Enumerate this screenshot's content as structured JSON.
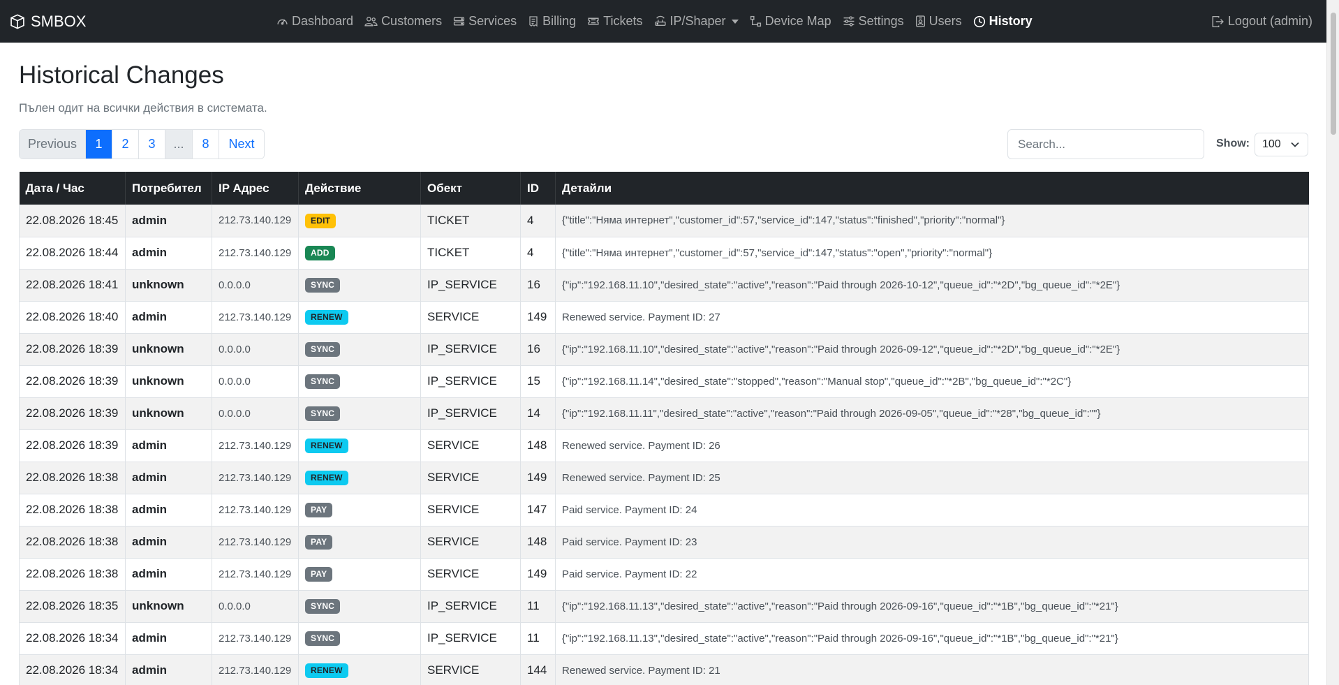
{
  "navbar": {
    "brand": "SMBOX",
    "items": [
      {
        "label": "Dashboard",
        "icon": "speedometer-icon"
      },
      {
        "label": "Customers",
        "icon": "people-icon"
      },
      {
        "label": "Services",
        "icon": "hdd-stack-icon"
      },
      {
        "label": "Billing",
        "icon": "receipt-icon"
      },
      {
        "label": "Tickets",
        "icon": "ticket-icon"
      },
      {
        "label": "IP/Shaper",
        "icon": "router-icon"
      },
      {
        "label": "Device Map",
        "icon": "diagram-icon"
      },
      {
        "label": "Settings",
        "icon": "sliders-icon"
      },
      {
        "label": "Users",
        "icon": "person-badge-icon"
      },
      {
        "label": "History",
        "icon": "clock-history-icon"
      }
    ],
    "logout": "Logout (admin)"
  },
  "header": {
    "title": "Historical Changes",
    "subtitle": "Пълен одит на всички действия в системата."
  },
  "pagination": {
    "previous": "Previous",
    "pages": [
      "1",
      "2",
      "3",
      "...",
      "8"
    ],
    "next": "Next"
  },
  "search": {
    "placeholder": "Search..."
  },
  "show": {
    "label": "Show:",
    "value": "100"
  },
  "table": {
    "columns": [
      "Дата / Час",
      "Потребител",
      "IP Адрес",
      "Действие",
      "Обект",
      "ID",
      "Детайли"
    ],
    "rows": [
      {
        "date": "22.08.2026 18:45",
        "user": "admin",
        "ip": "212.73.140.129",
        "action": "EDIT",
        "object": "TICKET",
        "id": "4",
        "details": "{\"title\":\"Няма интернет\",\"customer_id\":57,\"service_id\":147,\"status\":\"finished\",\"priority\":\"normal\"}"
      },
      {
        "date": "22.08.2026 18:44",
        "user": "admin",
        "ip": "212.73.140.129",
        "action": "ADD",
        "object": "TICKET",
        "id": "4",
        "details": "{\"title\":\"Няма интернет\",\"customer_id\":57,\"service_id\":147,\"status\":\"open\",\"priority\":\"normal\"}"
      },
      {
        "date": "22.08.2026 18:41",
        "user": "unknown",
        "ip": "0.0.0.0",
        "action": "SYNC",
        "object": "IP_SERVICE",
        "id": "16",
        "details": "{\"ip\":\"192.168.11.10\",\"desired_state\":\"active\",\"reason\":\"Paid through 2026-10-12\",\"queue_id\":\"*2D\",\"bg_queue_id\":\"*2E\"}"
      },
      {
        "date": "22.08.2026 18:40",
        "user": "admin",
        "ip": "212.73.140.129",
        "action": "RENEW",
        "object": "SERVICE",
        "id": "149",
        "details": "Renewed service. Payment ID: 27"
      },
      {
        "date": "22.08.2026 18:39",
        "user": "unknown",
        "ip": "0.0.0.0",
        "action": "SYNC",
        "object": "IP_SERVICE",
        "id": "16",
        "details": "{\"ip\":\"192.168.11.10\",\"desired_state\":\"active\",\"reason\":\"Paid through 2026-09-12\",\"queue_id\":\"*2D\",\"bg_queue_id\":\"*2E\"}"
      },
      {
        "date": "22.08.2026 18:39",
        "user": "unknown",
        "ip": "0.0.0.0",
        "action": "SYNC",
        "object": "IP_SERVICE",
        "id": "15",
        "details": "{\"ip\":\"192.168.11.14\",\"desired_state\":\"stopped\",\"reason\":\"Manual stop\",\"queue_id\":\"*2B\",\"bg_queue_id\":\"*2C\"}"
      },
      {
        "date": "22.08.2026 18:39",
        "user": "unknown",
        "ip": "0.0.0.0",
        "action": "SYNC",
        "object": "IP_SERVICE",
        "id": "14",
        "details": "{\"ip\":\"192.168.11.11\",\"desired_state\":\"active\",\"reason\":\"Paid through 2026-09-05\",\"queue_id\":\"*28\",\"bg_queue_id\":\"\"}"
      },
      {
        "date": "22.08.2026 18:39",
        "user": "admin",
        "ip": "212.73.140.129",
        "action": "RENEW",
        "object": "SERVICE",
        "id": "148",
        "details": "Renewed service. Payment ID: 26"
      },
      {
        "date": "22.08.2026 18:38",
        "user": "admin",
        "ip": "212.73.140.129",
        "action": "RENEW",
        "object": "SERVICE",
        "id": "149",
        "details": "Renewed service. Payment ID: 25"
      },
      {
        "date": "22.08.2026 18:38",
        "user": "admin",
        "ip": "212.73.140.129",
        "action": "PAY",
        "object": "SERVICE",
        "id": "147",
        "details": "Paid service. Payment ID: 24"
      },
      {
        "date": "22.08.2026 18:38",
        "user": "admin",
        "ip": "212.73.140.129",
        "action": "PAY",
        "object": "SERVICE",
        "id": "148",
        "details": "Paid service. Payment ID: 23"
      },
      {
        "date": "22.08.2026 18:38",
        "user": "admin",
        "ip": "212.73.140.129",
        "action": "PAY",
        "object": "SERVICE",
        "id": "149",
        "details": "Paid service. Payment ID: 22"
      },
      {
        "date": "22.08.2026 18:35",
        "user": "unknown",
        "ip": "0.0.0.0",
        "action": "SYNC",
        "object": "IP_SERVICE",
        "id": "11",
        "details": "{\"ip\":\"192.168.11.13\",\"desired_state\":\"active\",\"reason\":\"Paid through 2026-09-16\",\"queue_id\":\"*1B\",\"bg_queue_id\":\"*21\"}"
      },
      {
        "date": "22.08.2026 18:34",
        "user": "admin",
        "ip": "212.73.140.129",
        "action": "SYNC",
        "object": "IP_SERVICE",
        "id": "11",
        "details": "{\"ip\":\"192.168.11.13\",\"desired_state\":\"active\",\"reason\":\"Paid through 2026-09-16\",\"queue_id\":\"*1B\",\"bg_queue_id\":\"*21\"}"
      },
      {
        "date": "22.08.2026 18:34",
        "user": "admin",
        "ip": "212.73.140.129",
        "action": "RENEW",
        "object": "SERVICE",
        "id": "144",
        "details": "Renewed service. Payment ID: 21"
      }
    ]
  },
  "colors": {
    "navbar_bg": "#212529",
    "primary": "#0d6efd",
    "badge_edit": "#ffc107",
    "badge_add": "#198754",
    "badge_sync": "#6c757d",
    "badge_renew": "#0dcaf0",
    "badge_pay": "#6c757d"
  }
}
